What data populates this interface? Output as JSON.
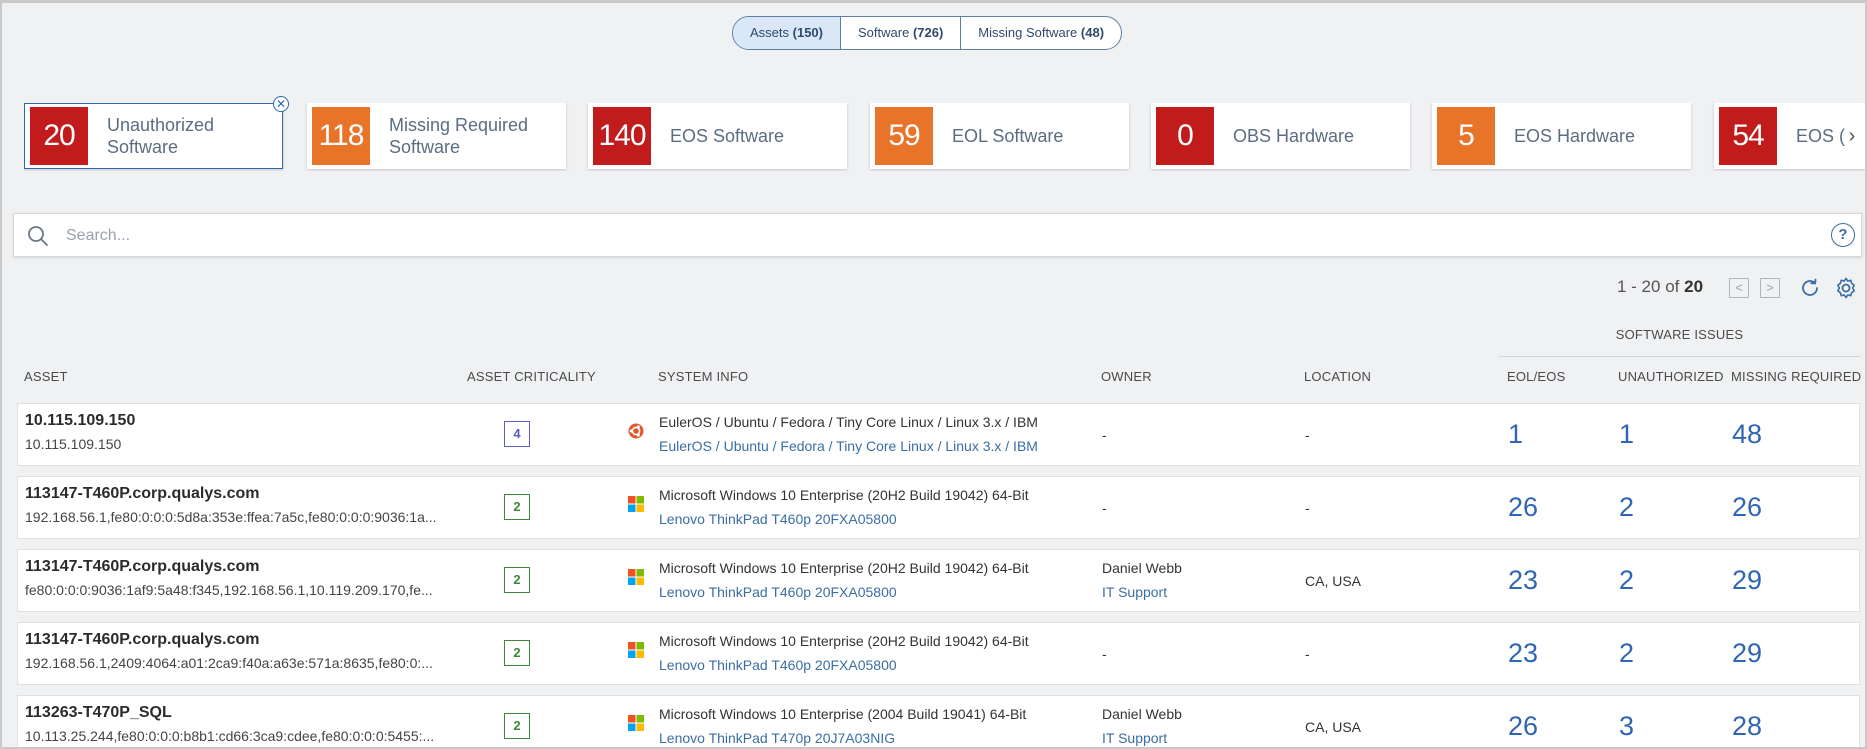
{
  "tabs": [
    {
      "label": "Assets",
      "count": "(150)",
      "active": true
    },
    {
      "label": "Software",
      "count": "(726)",
      "active": false
    },
    {
      "label": "Missing Software",
      "count": "(48)",
      "active": false
    }
  ],
  "cards": [
    {
      "value": "20",
      "label_1": "Unauthorized",
      "label_2": "Software",
      "color": "red",
      "selected": true
    },
    {
      "value": "118",
      "label_1": "Missing Required",
      "label_2": "Software",
      "color": "orange"
    },
    {
      "value": "140",
      "label_1": "EOS Software",
      "label_2": "",
      "color": "red"
    },
    {
      "value": "59",
      "label_1": "EOL Software",
      "label_2": "",
      "color": "orange"
    },
    {
      "value": "0",
      "label_1": "OBS Hardware",
      "label_2": "",
      "color": "red"
    },
    {
      "value": "5",
      "label_1": "EOS Hardware",
      "label_2": "",
      "color": "orange"
    },
    {
      "value": "54",
      "label_1": "EOS (",
      "label_2": "",
      "color": "red"
    }
  ],
  "colors": {
    "red": "#c21b1b",
    "orange": "#e8742a",
    "accent": "#2f66b3",
    "link": "#3a6ea5"
  },
  "search": {
    "placeholder": "Search..."
  },
  "pagination": {
    "range": "1 - 20 of",
    "total": "20"
  },
  "table": {
    "group_header": "SOFTWARE ISSUES",
    "columns": {
      "asset": "ASSET",
      "criticality": "ASSET CRITICALITY",
      "system_info": "SYSTEM INFO",
      "owner": "OWNER",
      "location": "LOCATION",
      "eol_eos": "EOL/EOS",
      "unauthorized": "UNAUTHORIZED",
      "missing_required": "MISSING REQUIRED"
    },
    "rows": [
      {
        "name": "10.115.109.150",
        "ip": "10.115.109.150",
        "criticality": "4",
        "os_icon": "ubuntu-icon",
        "system_1": "EulerOS / Ubuntu / Fedora / Tiny Core Linux / Linux 3.x / IBM",
        "system_2": "EulerOS / Ubuntu / Fedora / Tiny Core Linux / Linux 3.x / IBM",
        "owner": "-",
        "owner_dept": "",
        "location": "-",
        "eol_eos": "1",
        "unauthorized": "1",
        "missing_required": "48"
      },
      {
        "name": "113147-T460P.corp.qualys.com",
        "ip": "192.168.56.1,fe80:0:0:0:5d8a:353e:ffea:7a5c,fe80:0:0:0:9036:1a...",
        "criticality": "2",
        "os_icon": "windows-icon",
        "system_1": "Microsoft Windows 10 Enterprise (20H2 Build 19042) 64-Bit",
        "system_2": "Lenovo ThinkPad T460p 20FXA05800",
        "owner": "-",
        "owner_dept": "",
        "location": "-",
        "eol_eos": "26",
        "unauthorized": "2",
        "missing_required": "26"
      },
      {
        "name": "113147-T460P.corp.qualys.com",
        "ip": "fe80:0:0:0:9036:1af9:5a48:f345,192.168.56.1,10.119.209.170,fe...",
        "criticality": "2",
        "os_icon": "windows-icon",
        "system_1": "Microsoft Windows 10 Enterprise (20H2 Build 19042) 64-Bit",
        "system_2": "Lenovo ThinkPad T460p 20FXA05800",
        "owner": "Daniel Webb",
        "owner_dept": "IT Support",
        "location": "CA, USA",
        "eol_eos": "23",
        "unauthorized": "2",
        "missing_required": "29"
      },
      {
        "name": "113147-T460P.corp.qualys.com",
        "ip": "192.168.56.1,2409:4064:a01:2ca9:f40a:a63e:571a:8635,fe80:0:...",
        "criticality": "2",
        "os_icon": "windows-icon",
        "system_1": "Microsoft Windows 10 Enterprise (20H2 Build 19042) 64-Bit",
        "system_2": "Lenovo ThinkPad T460p 20FXA05800",
        "owner": "-",
        "owner_dept": "",
        "location": "-",
        "eol_eos": "23",
        "unauthorized": "2",
        "missing_required": "29"
      },
      {
        "name": "113263-T470P_SQL",
        "ip": "10.113.25.244,fe80:0:0:0:b8b1:cd66:3ca9:cdee,fe80:0:0:0:5455:...",
        "criticality": "2",
        "os_icon": "windows-icon",
        "system_1": "Microsoft Windows 10 Enterprise (2004 Build 19041) 64-Bit",
        "system_2": "Lenovo ThinkPad T470p 20J7A03NIG",
        "owner": "Daniel Webb",
        "owner_dept": "IT Support",
        "location": "CA, USA",
        "eol_eos": "26",
        "unauthorized": "3",
        "missing_required": "28"
      }
    ]
  }
}
